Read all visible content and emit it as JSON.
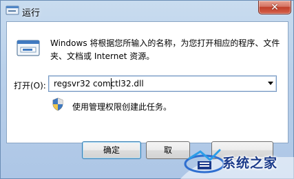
{
  "window": {
    "title": "运行",
    "close_glyph": "✕"
  },
  "dialog": {
    "description": "Windows 将根据您所输入的名称，为您打开相应的程序、文件夹、文档或 Internet 资源。",
    "open_label": "打开(O):",
    "command_value": "regsvr32 comctl32.dll",
    "admin_note": "使用管理权限创建此任务。"
  },
  "buttons": {
    "ok": "确定",
    "cancel": "取",
    "browse": ""
  },
  "icons": {
    "title": "run-icon",
    "app": "run-program-icon",
    "shield": "uac-shield-icon",
    "dropdown": "chevron-down-icon"
  },
  "watermark": {
    "text": "系统之家"
  }
}
